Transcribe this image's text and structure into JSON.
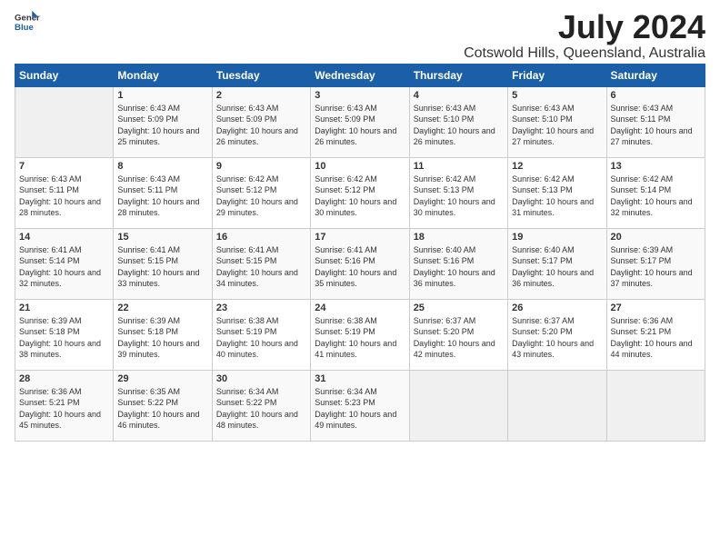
{
  "header": {
    "logo_general": "General",
    "logo_blue": "Blue",
    "month_year": "July 2024",
    "location": "Cotswold Hills, Queensland, Australia"
  },
  "days_of_week": [
    "Sunday",
    "Monday",
    "Tuesday",
    "Wednesday",
    "Thursday",
    "Friday",
    "Saturday"
  ],
  "weeks": [
    [
      {
        "day": "",
        "empty": true
      },
      {
        "day": "1",
        "sunrise": "Sunrise: 6:43 AM",
        "sunset": "Sunset: 5:09 PM",
        "daylight": "Daylight: 10 hours and 25 minutes."
      },
      {
        "day": "2",
        "sunrise": "Sunrise: 6:43 AM",
        "sunset": "Sunset: 5:09 PM",
        "daylight": "Daylight: 10 hours and 26 minutes."
      },
      {
        "day": "3",
        "sunrise": "Sunrise: 6:43 AM",
        "sunset": "Sunset: 5:09 PM",
        "daylight": "Daylight: 10 hours and 26 minutes."
      },
      {
        "day": "4",
        "sunrise": "Sunrise: 6:43 AM",
        "sunset": "Sunset: 5:10 PM",
        "daylight": "Daylight: 10 hours and 26 minutes."
      },
      {
        "day": "5",
        "sunrise": "Sunrise: 6:43 AM",
        "sunset": "Sunset: 5:10 PM",
        "daylight": "Daylight: 10 hours and 27 minutes."
      },
      {
        "day": "6",
        "sunrise": "Sunrise: 6:43 AM",
        "sunset": "Sunset: 5:11 PM",
        "daylight": "Daylight: 10 hours and 27 minutes."
      }
    ],
    [
      {
        "day": "7",
        "sunrise": "Sunrise: 6:43 AM",
        "sunset": "Sunset: 5:11 PM",
        "daylight": "Daylight: 10 hours and 28 minutes."
      },
      {
        "day": "8",
        "sunrise": "Sunrise: 6:43 AM",
        "sunset": "Sunset: 5:11 PM",
        "daylight": "Daylight: 10 hours and 28 minutes."
      },
      {
        "day": "9",
        "sunrise": "Sunrise: 6:42 AM",
        "sunset": "Sunset: 5:12 PM",
        "daylight": "Daylight: 10 hours and 29 minutes."
      },
      {
        "day": "10",
        "sunrise": "Sunrise: 6:42 AM",
        "sunset": "Sunset: 5:12 PM",
        "daylight": "Daylight: 10 hours and 30 minutes."
      },
      {
        "day": "11",
        "sunrise": "Sunrise: 6:42 AM",
        "sunset": "Sunset: 5:13 PM",
        "daylight": "Daylight: 10 hours and 30 minutes."
      },
      {
        "day": "12",
        "sunrise": "Sunrise: 6:42 AM",
        "sunset": "Sunset: 5:13 PM",
        "daylight": "Daylight: 10 hours and 31 minutes."
      },
      {
        "day": "13",
        "sunrise": "Sunrise: 6:42 AM",
        "sunset": "Sunset: 5:14 PM",
        "daylight": "Daylight: 10 hours and 32 minutes."
      }
    ],
    [
      {
        "day": "14",
        "sunrise": "Sunrise: 6:41 AM",
        "sunset": "Sunset: 5:14 PM",
        "daylight": "Daylight: 10 hours and 32 minutes."
      },
      {
        "day": "15",
        "sunrise": "Sunrise: 6:41 AM",
        "sunset": "Sunset: 5:15 PM",
        "daylight": "Daylight: 10 hours and 33 minutes."
      },
      {
        "day": "16",
        "sunrise": "Sunrise: 6:41 AM",
        "sunset": "Sunset: 5:15 PM",
        "daylight": "Daylight: 10 hours and 34 minutes."
      },
      {
        "day": "17",
        "sunrise": "Sunrise: 6:41 AM",
        "sunset": "Sunset: 5:16 PM",
        "daylight": "Daylight: 10 hours and 35 minutes."
      },
      {
        "day": "18",
        "sunrise": "Sunrise: 6:40 AM",
        "sunset": "Sunset: 5:16 PM",
        "daylight": "Daylight: 10 hours and 36 minutes."
      },
      {
        "day": "19",
        "sunrise": "Sunrise: 6:40 AM",
        "sunset": "Sunset: 5:17 PM",
        "daylight": "Daylight: 10 hours and 36 minutes."
      },
      {
        "day": "20",
        "sunrise": "Sunrise: 6:39 AM",
        "sunset": "Sunset: 5:17 PM",
        "daylight": "Daylight: 10 hours and 37 minutes."
      }
    ],
    [
      {
        "day": "21",
        "sunrise": "Sunrise: 6:39 AM",
        "sunset": "Sunset: 5:18 PM",
        "daylight": "Daylight: 10 hours and 38 minutes."
      },
      {
        "day": "22",
        "sunrise": "Sunrise: 6:39 AM",
        "sunset": "Sunset: 5:18 PM",
        "daylight": "Daylight: 10 hours and 39 minutes."
      },
      {
        "day": "23",
        "sunrise": "Sunrise: 6:38 AM",
        "sunset": "Sunset: 5:19 PM",
        "daylight": "Daylight: 10 hours and 40 minutes."
      },
      {
        "day": "24",
        "sunrise": "Sunrise: 6:38 AM",
        "sunset": "Sunset: 5:19 PM",
        "daylight": "Daylight: 10 hours and 41 minutes."
      },
      {
        "day": "25",
        "sunrise": "Sunrise: 6:37 AM",
        "sunset": "Sunset: 5:20 PM",
        "daylight": "Daylight: 10 hours and 42 minutes."
      },
      {
        "day": "26",
        "sunrise": "Sunrise: 6:37 AM",
        "sunset": "Sunset: 5:20 PM",
        "daylight": "Daylight: 10 hours and 43 minutes."
      },
      {
        "day": "27",
        "sunrise": "Sunrise: 6:36 AM",
        "sunset": "Sunset: 5:21 PM",
        "daylight": "Daylight: 10 hours and 44 minutes."
      }
    ],
    [
      {
        "day": "28",
        "sunrise": "Sunrise: 6:36 AM",
        "sunset": "Sunset: 5:21 PM",
        "daylight": "Daylight: 10 hours and 45 minutes."
      },
      {
        "day": "29",
        "sunrise": "Sunrise: 6:35 AM",
        "sunset": "Sunset: 5:22 PM",
        "daylight": "Daylight: 10 hours and 46 minutes."
      },
      {
        "day": "30",
        "sunrise": "Sunrise: 6:34 AM",
        "sunset": "Sunset: 5:22 PM",
        "daylight": "Daylight: 10 hours and 48 minutes."
      },
      {
        "day": "31",
        "sunrise": "Sunrise: 6:34 AM",
        "sunset": "Sunset: 5:23 PM",
        "daylight": "Daylight: 10 hours and 49 minutes."
      },
      {
        "day": "",
        "empty": true
      },
      {
        "day": "",
        "empty": true
      },
      {
        "day": "",
        "empty": true
      }
    ]
  ]
}
